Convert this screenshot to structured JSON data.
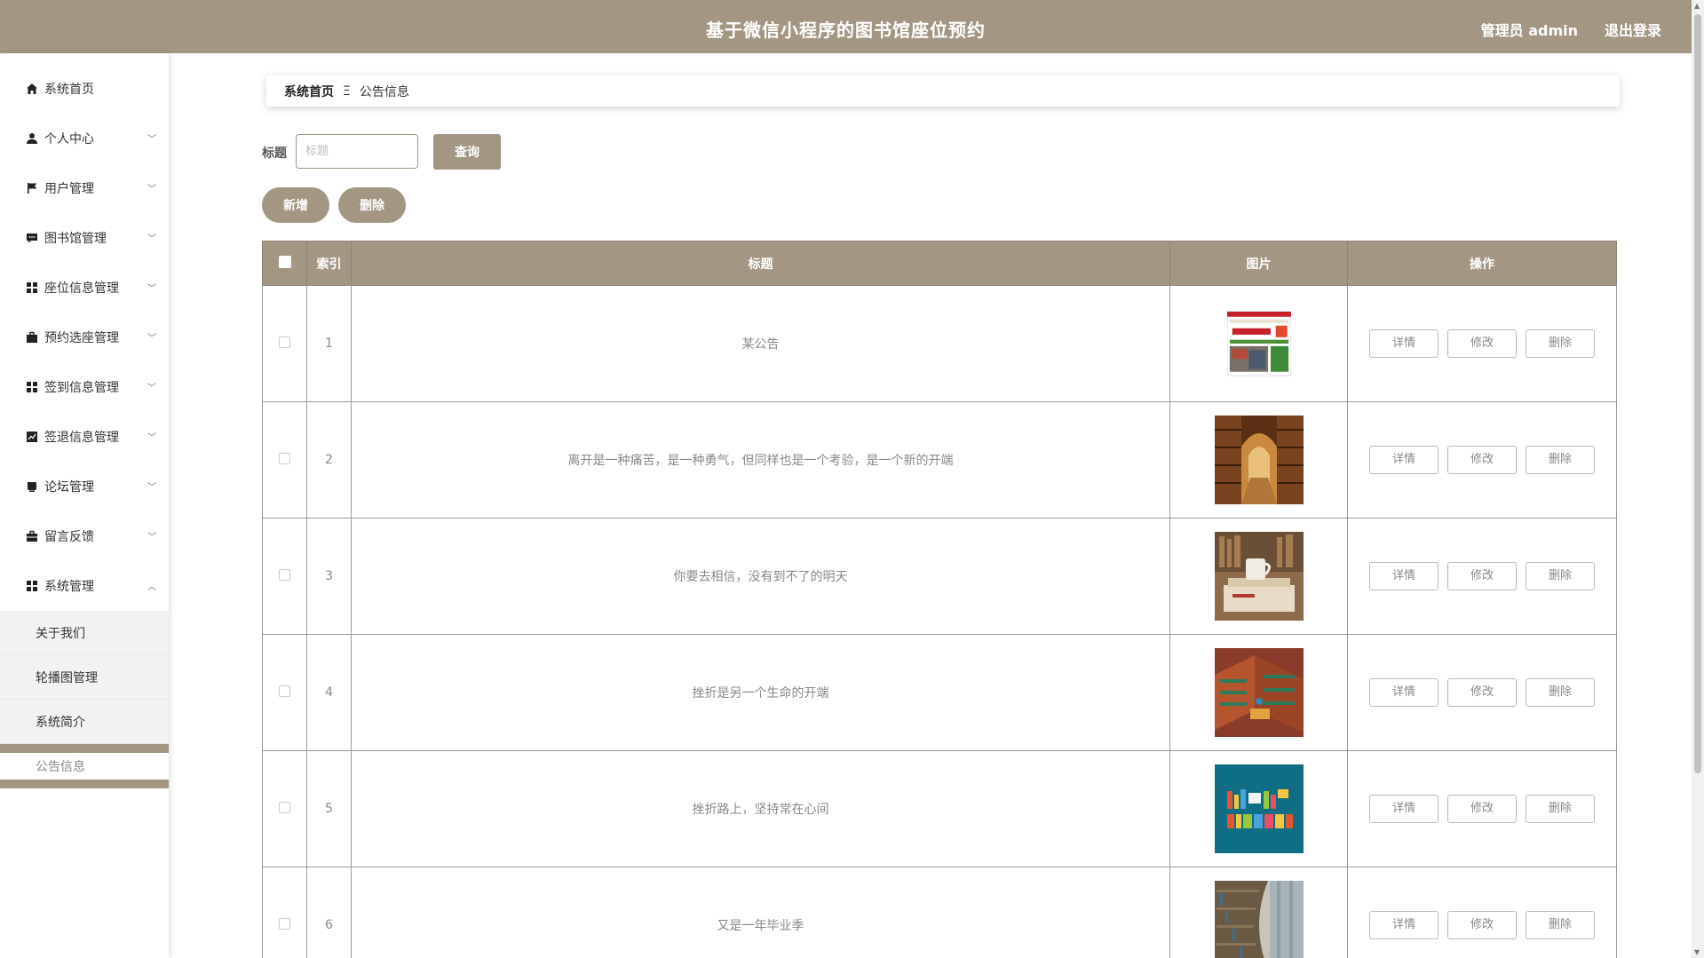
{
  "header": {
    "title": "基于微信小程序的图书馆座位预约",
    "user_label": "管理员 admin",
    "logout_label": "退出登录"
  },
  "sidebar": {
    "items": [
      {
        "label": "系统首页",
        "icon": "home-icon",
        "has_chevron": false
      },
      {
        "label": "个人中心",
        "icon": "user-icon",
        "has_chevron": true
      },
      {
        "label": "用户管理",
        "icon": "flag-icon",
        "has_chevron": true
      },
      {
        "label": "图书馆管理",
        "icon": "chat-icon",
        "has_chevron": true
      },
      {
        "label": "座位信息管理",
        "icon": "grid-icon",
        "has_chevron": true
      },
      {
        "label": "预约选座管理",
        "icon": "briefcase-icon",
        "has_chevron": true
      },
      {
        "label": "签到信息管理",
        "icon": "grid-icon",
        "has_chevron": true
      },
      {
        "label": "签退信息管理",
        "icon": "chart-icon",
        "has_chevron": true
      },
      {
        "label": "论坛管理",
        "icon": "cup-icon",
        "has_chevron": true
      },
      {
        "label": "留言反馈",
        "icon": "briefcase-icon",
        "has_chevron": true
      },
      {
        "label": "系统管理",
        "icon": "grid-icon",
        "has_chevron": true,
        "expanded": true
      }
    ],
    "subitems": [
      {
        "label": "关于我们",
        "active": false
      },
      {
        "label": "轮播图管理",
        "active": false
      },
      {
        "label": "系统简介",
        "active": false
      },
      {
        "label": "公告信息",
        "active": true
      }
    ]
  },
  "breadcrumb": {
    "home": "系统首页",
    "separator": "Ξ",
    "current": "公告信息"
  },
  "search": {
    "label": "标题",
    "placeholder": "标题",
    "value": "",
    "button": "查询"
  },
  "actions": {
    "add": "新增",
    "delete": "删除"
  },
  "table": {
    "headers": {
      "index": "索引",
      "title": "标题",
      "image": "图片",
      "ops": "操作"
    },
    "op_labels": {
      "detail": "详情",
      "edit": "修改",
      "delete": "删除"
    },
    "rows": [
      {
        "index": "1",
        "title": "某公告",
        "image": "book-cover"
      },
      {
        "index": "2",
        "title": "离开是一种痛苦，是一种勇气，但同样也是一个考验，是一个新的开端",
        "image": "library-arch"
      },
      {
        "index": "3",
        "title": "你要去相信，没有到不了的明天",
        "image": "books-cup"
      },
      {
        "index": "4",
        "title": "挫折是另一个生命的开端",
        "image": "library-isometric"
      },
      {
        "index": "5",
        "title": "挫折路上，坚持常在心间",
        "image": "library-word"
      },
      {
        "index": "6",
        "title": "又是一年毕业季",
        "image": "bookshelf-curve"
      }
    ]
  },
  "colors": {
    "accent": "#a39683"
  }
}
